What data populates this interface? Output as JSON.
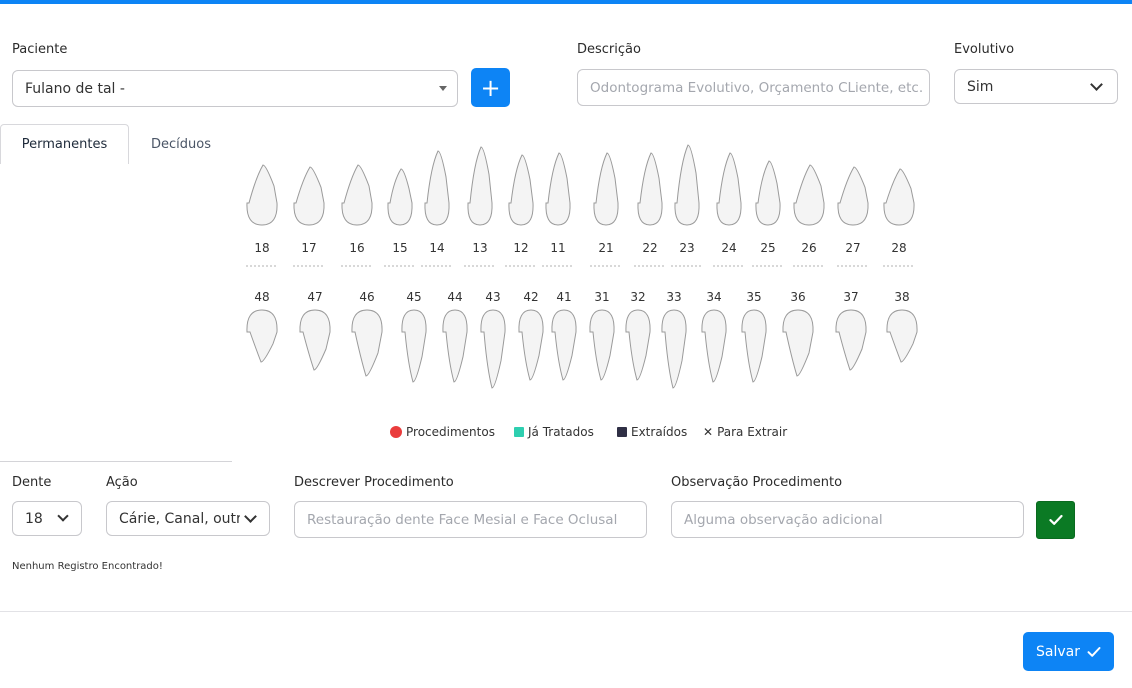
{
  "form": {
    "paciente_label": "Paciente",
    "paciente_value": "Fulano de tal -",
    "add_button": "+",
    "descricao_label": "Descrição",
    "descricao_placeholder": "Odontograma Evolutivo, Orçamento CLiente, etc.",
    "evolutivo_label": "Evolutivo",
    "evolutivo_value": "Sim"
  },
  "tabs": [
    {
      "label": "Permanentes",
      "active": true
    },
    {
      "label": "Decíduos",
      "active": false
    }
  ],
  "teeth": {
    "upper": [
      "18",
      "17",
      "16",
      "15",
      "14",
      "13",
      "12",
      "11",
      "21",
      "22",
      "23",
      "24",
      "25",
      "26",
      "27",
      "28"
    ],
    "lower": [
      "48",
      "47",
      "46",
      "45",
      "44",
      "43",
      "42",
      "41",
      "31",
      "32",
      "33",
      "34",
      "35",
      "36",
      "37",
      "38"
    ]
  },
  "legend": [
    {
      "label": "Procedimentos",
      "color": "#ea3c3c",
      "icon": "circle"
    },
    {
      "label": "Já Tratados",
      "color": "#2ecfb0",
      "icon": "square"
    },
    {
      "label": "Extraídos",
      "color": "#2f2f45",
      "icon": "square"
    },
    {
      "label": "Para Extrair",
      "color": "#333333",
      "icon": "x"
    }
  ],
  "procedure": {
    "dente_label": "Dente",
    "dente_value": "18",
    "acao_label": "Ação",
    "acao_value": "Cárie, Canal, outros",
    "descrever_label": "Descrever Procedimento",
    "descrever_placeholder": "Restauração dente Face Mesial e Face Oclusal",
    "observacao_label": "Observação Procedimento",
    "observacao_placeholder": "Alguma observação adicional",
    "empty_message": "Nenhum Registro Encontrado!"
  },
  "footer": {
    "save_label": "Salvar"
  },
  "colors": {
    "primary": "#0d84f5",
    "confirm": "#0b7a24"
  }
}
